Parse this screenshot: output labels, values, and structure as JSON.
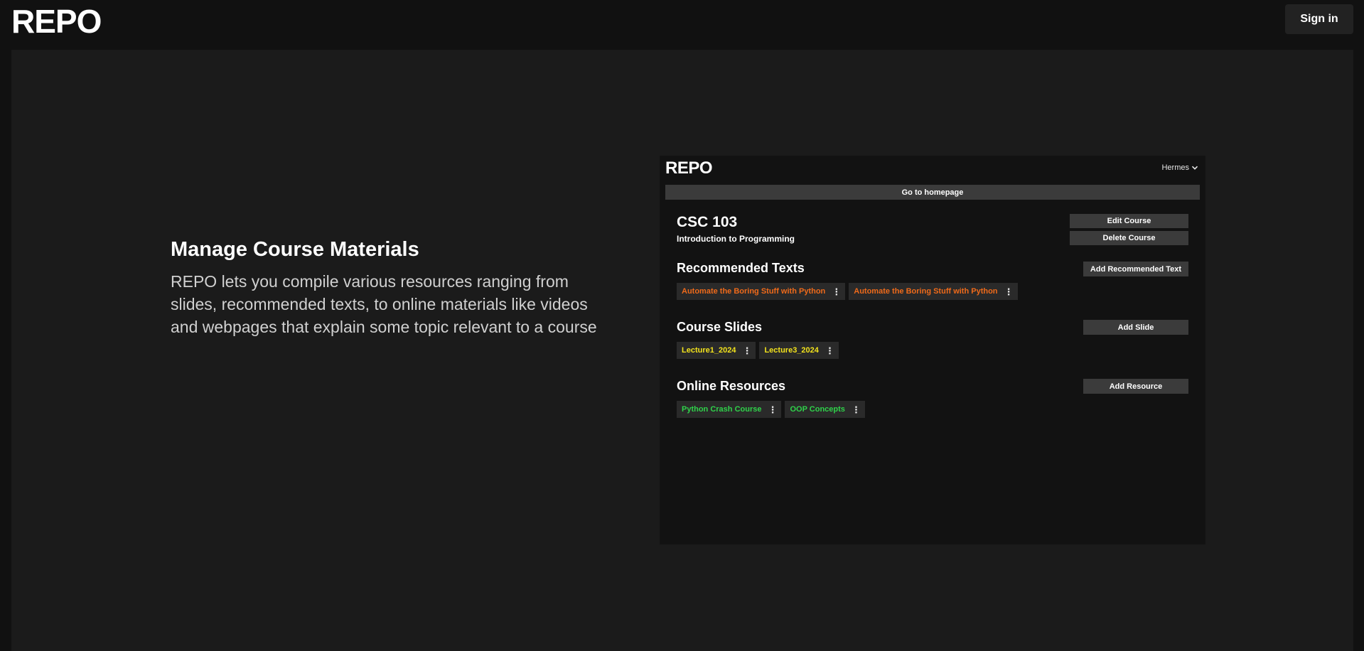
{
  "header": {
    "brand": "REPO",
    "sign_in_label": "Sign in"
  },
  "feature": {
    "title": "Manage Course Materials",
    "description": "REPO lets you compile various resources ranging from slides, recommended texts, to online materials like videos and webpages that explain some topic relevant to a course"
  },
  "preview": {
    "brand": "REPO",
    "user_name": "Hermes",
    "user_menu_icon": "chevron-down-icon",
    "go_home_label": "Go to homepage",
    "course_code": "CSC 103",
    "course_name": "Introduction to Programming",
    "edit_course_label": "Edit Course",
    "delete_course_label": "Delete Course",
    "sections": {
      "texts": {
        "title": "Recommended Texts",
        "add_label": "Add Recommended Text",
        "color": "#ef6a1a",
        "items": [
          "Automate the Boring Stuff with Python",
          "Automate the Boring Stuff with Python"
        ]
      },
      "slides": {
        "title": "Course Slides",
        "add_label": "Add Slide",
        "color": "#f2e21c",
        "items": [
          "Lecture1_2024",
          "Lecture3_2024"
        ]
      },
      "resources": {
        "title": "Online Resources",
        "add_label": "Add Resource",
        "color": "#2fd24a",
        "items": [
          "Python Crash Course",
          "OOP Concepts"
        ]
      }
    },
    "item_menu_icon": "more-vertical-icon"
  },
  "colors": {
    "page_bg": "#111111",
    "panel_bg": "#1b1b1b",
    "button_bg": "#3b3b3b"
  }
}
